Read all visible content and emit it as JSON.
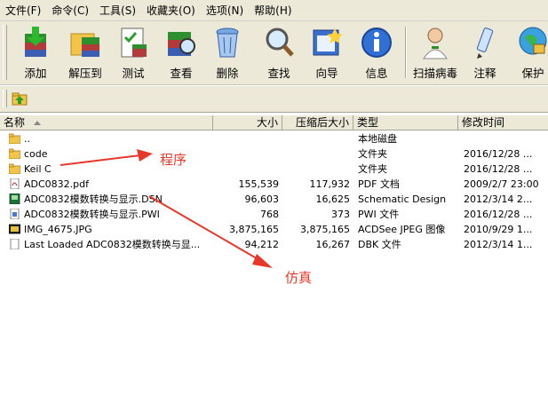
{
  "menu": [
    "文件(F)",
    "命令(C)",
    "工具(S)",
    "收藏夹(O)",
    "选项(N)",
    "帮助(H)"
  ],
  "toolbar": [
    {
      "label": "添加",
      "icon": "add-icon"
    },
    {
      "label": "解压到",
      "icon": "extract-icon"
    },
    {
      "label": "测试",
      "icon": "test-icon"
    },
    {
      "label": "查看",
      "icon": "view-icon"
    },
    {
      "label": "删除",
      "icon": "delete-icon"
    },
    {
      "label": "查找",
      "icon": "find-icon"
    },
    {
      "label": "向导",
      "icon": "wizard-icon"
    },
    {
      "label": "信息",
      "icon": "info-icon"
    },
    {
      "label": "扫描病毒",
      "icon": "virus-scan-icon"
    },
    {
      "label": "注释",
      "icon": "comment-icon"
    },
    {
      "label": "保护",
      "icon": "protect-icon"
    }
  ],
  "columns": {
    "name": "名称",
    "size": "大小",
    "packed": "压缩后大小",
    "type": "类型",
    "modified": "修改时间"
  },
  "rows": [
    {
      "name": "..",
      "icon": "folder-icon",
      "size": "",
      "packed": "",
      "type": "本地磁盘",
      "modified": ""
    },
    {
      "name": "code",
      "icon": "folder-icon",
      "size": "",
      "packed": "",
      "type": "文件夹",
      "modified": "2016/12/28 ..."
    },
    {
      "name": "Keil C",
      "icon": "folder-icon",
      "size": "",
      "packed": "",
      "type": "文件夹",
      "modified": "2016/12/28 ..."
    },
    {
      "name": "ADC0832.pdf",
      "icon": "pdf-file-icon",
      "size": "155,539",
      "packed": "117,932",
      "type": "PDF 文档",
      "modified": "2009/2/7 23:00"
    },
    {
      "name": "ADC0832模数转换与显示.DSN",
      "icon": "dsn-file-icon",
      "size": "96,603",
      "packed": "16,625",
      "type": "Schematic Design",
      "modified": "2012/3/14 2..."
    },
    {
      "name": "ADC0832模数转换与显示.PWI",
      "icon": "pwi-file-icon",
      "size": "768",
      "packed": "373",
      "type": "PWI 文件",
      "modified": "2016/12/28 ..."
    },
    {
      "name": "IMG_4675.JPG",
      "icon": "jpg-file-icon",
      "size": "3,875,165",
      "packed": "3,875,165",
      "type": "ACDSee JPEG 图像",
      "modified": "2010/9/29 1..."
    },
    {
      "name": "Last Loaded ADC0832模数转换与显...",
      "icon": "dbk-file-icon",
      "size": "94,212",
      "packed": "16,267",
      "type": "DBK 文件",
      "modified": "2012/3/14 1..."
    }
  ],
  "annotations": {
    "program": "程序",
    "simulation": "仿真"
  },
  "colors": {
    "annotation": "#e8382a",
    "toolbar_bg": "#ece9d8"
  }
}
